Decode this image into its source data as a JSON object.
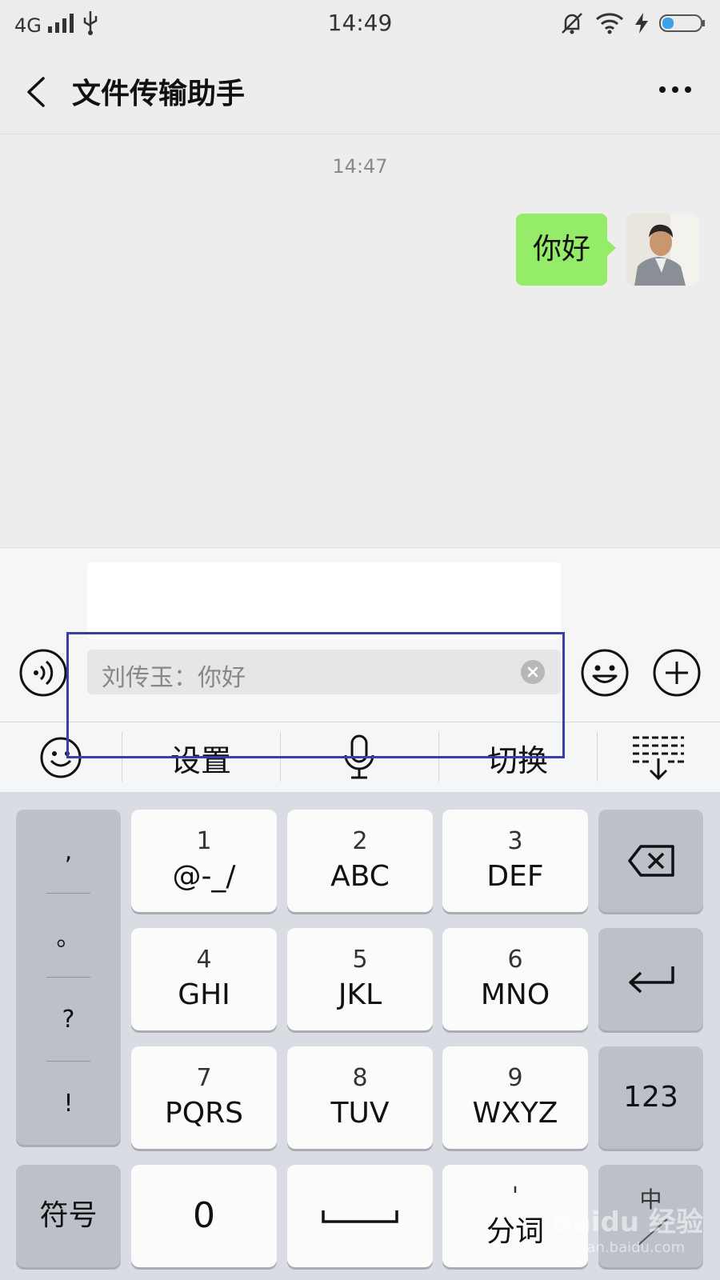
{
  "status_bar": {
    "network": "4G",
    "time": "14:49"
  },
  "header": {
    "title": "文件传输助手"
  },
  "chat": {
    "timestamp": "14:47",
    "messages": [
      {
        "text": "你好",
        "sender": "self"
      }
    ]
  },
  "input": {
    "value": "",
    "quote": "刘传玉：你好"
  },
  "keyboard_toolbar": {
    "settings_label": "设置",
    "switch_label": "切换"
  },
  "keyboard": {
    "punctuation": [
      ",",
      "。",
      "?",
      "!"
    ],
    "keys": [
      {
        "num": "1",
        "letters": "@-_/"
      },
      {
        "num": "2",
        "letters": "ABC"
      },
      {
        "num": "3",
        "letters": "DEF"
      },
      {
        "num": "4",
        "letters": "GHI"
      },
      {
        "num": "5",
        "letters": "JKL"
      },
      {
        "num": "6",
        "letters": "MNO"
      },
      {
        "num": "7",
        "letters": "PQRS"
      },
      {
        "num": "8",
        "letters": "TUV"
      },
      {
        "num": "9",
        "letters": "WXYZ"
      }
    ],
    "numbers_label": "123",
    "symbols_label": "符号",
    "zero_label": "0",
    "segment_label": "分词",
    "segment_mark": "'",
    "lang_label": "中"
  },
  "watermark": {
    "brand": "Baidu 经验",
    "url": "jingyan.baidu.com"
  }
}
